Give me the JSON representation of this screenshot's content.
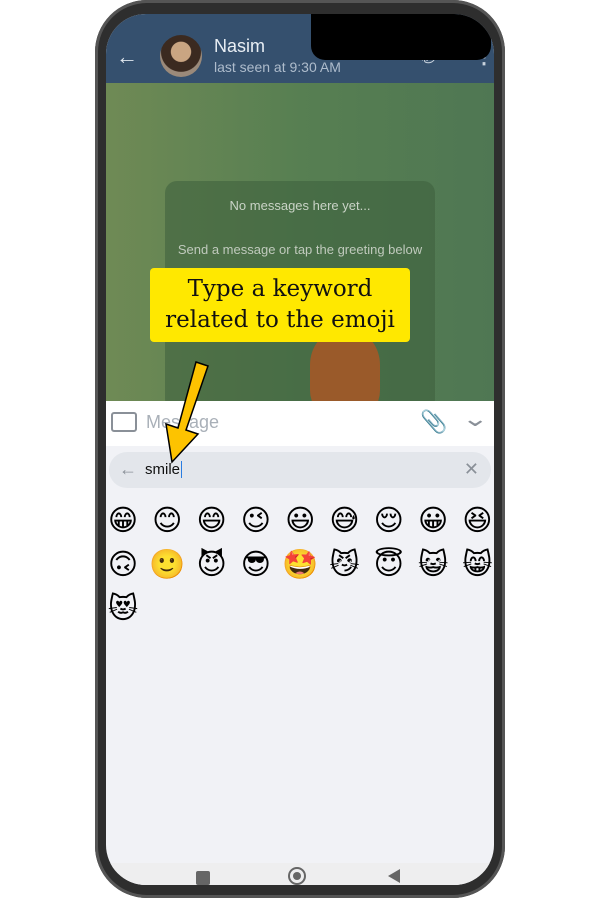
{
  "header": {
    "contact_name": "Nasim",
    "last_seen": "last seen at 9:30 AM"
  },
  "chat": {
    "empty_title": "No messages here yet...",
    "empty_subtitle": "Send a message or tap the greeting below"
  },
  "composer": {
    "placeholder": "Message"
  },
  "emoji_search": {
    "value": "smile"
  },
  "emojis": [
    "😁",
    "😊",
    "😄",
    "😉",
    "😃",
    "😅",
    "😌",
    "😀",
    "😆",
    "🙃",
    "🙂",
    "😈",
    "😎",
    "🤩",
    "😼",
    "😇",
    "😺",
    "😸",
    "😻"
  ],
  "callout": {
    "line1": "Type a keyword",
    "line2": "related to the emoji",
    "color": "#ffe800",
    "arrow_color": "#fdc300"
  },
  "colors": {
    "header": "#35506e",
    "panel": "#f1f2f6"
  }
}
